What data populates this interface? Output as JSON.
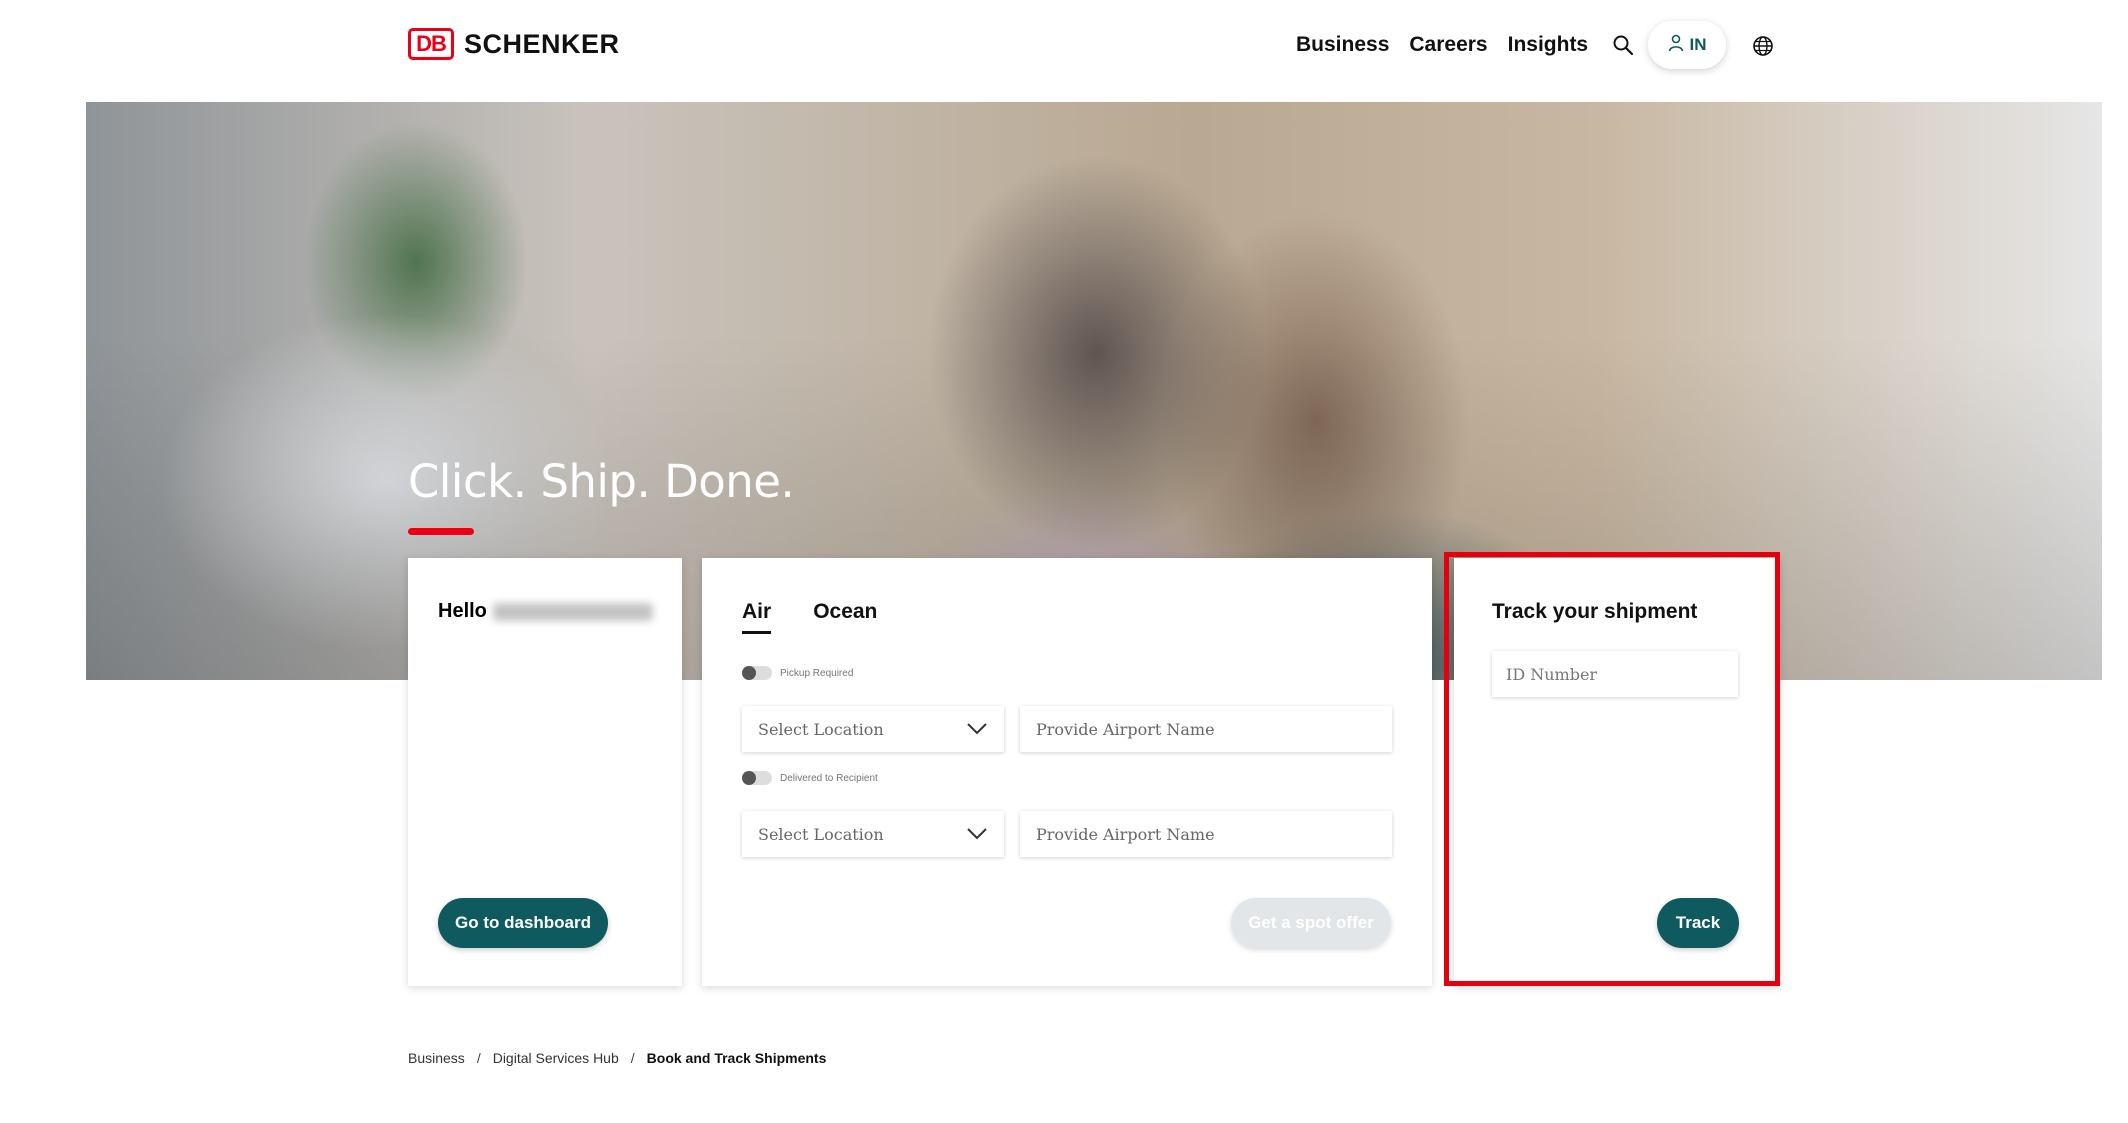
{
  "header": {
    "logo_mark": "DB",
    "logo_text": "SCHENKER",
    "nav": [
      "Business",
      "Careers",
      "Insights"
    ],
    "login_label": "IN",
    "icons": [
      "search-icon",
      "user-icon",
      "globe-icon"
    ]
  },
  "hero": {
    "title": "Click. Ship. Done.",
    "accent_color": "#ec0016"
  },
  "hello_card": {
    "greeting": "Hello",
    "dashboard_button": "Go to dashboard"
  },
  "booking_card": {
    "tabs": [
      "Air",
      "Ocean"
    ],
    "active_tab": "Air",
    "pickup_toggle_label": "Pickup Required",
    "delivery_toggle_label": "Delivered to Recipient",
    "origin_select": "Select Location",
    "origin_airport_placeholder": "Provide Airport Name",
    "destination_select": "Select Location",
    "destination_airport_placeholder": "Provide Airport Name",
    "spot_offer_button": "Get a spot offer"
  },
  "track_card": {
    "title": "Track your shipment",
    "id_placeholder": "ID Number",
    "track_button": "Track",
    "highlight_color": "#e3000f"
  },
  "breadcrumb": [
    "Business",
    "Digital Services Hub",
    "Book and Track Shipments"
  ],
  "colors": {
    "primary": "#0e5a5e",
    "brand_red": "#ec0016",
    "disabled_button": "#e3e6e8"
  }
}
